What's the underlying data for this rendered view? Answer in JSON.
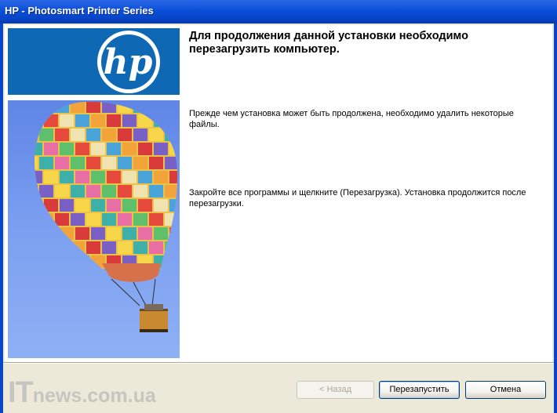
{
  "window": {
    "title": "HP - Photosmart Printer Series"
  },
  "logo": {
    "text": "hp",
    "color": "#0f68b3"
  },
  "content": {
    "heading": "Для продолжения данной установки необходимо перезагрузить компьютер.",
    "paragraph1": "Прежде чем установка может быть продолжена, необходимо удалить некоторые файлы.",
    "paragraph2": "Закройте все программы и щелкните  (Перезагрузка). Установка продолжится после перезагрузки."
  },
  "buttons": {
    "back": "< Назад",
    "restart": "Перезапустить",
    "cancel": "Отмена"
  },
  "watermark": {
    "part1": "IT",
    "part2": "news",
    "part3": ".com.ua"
  }
}
